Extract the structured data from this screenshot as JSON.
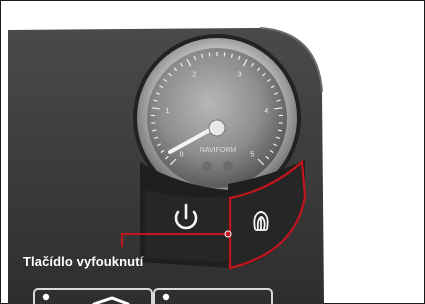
{
  "callout": {
    "label": "Tlačídlo vyfouknutí",
    "highlight_color": "#c4141d"
  },
  "gauge": {
    "brand_text": "NAVIFORM",
    "scale_labels": [
      "0",
      "1",
      "2",
      "3",
      "4",
      "5"
    ]
  },
  "buttons": {
    "power_icon": "power-icon",
    "deflate_icon": "deflate-icon"
  }
}
